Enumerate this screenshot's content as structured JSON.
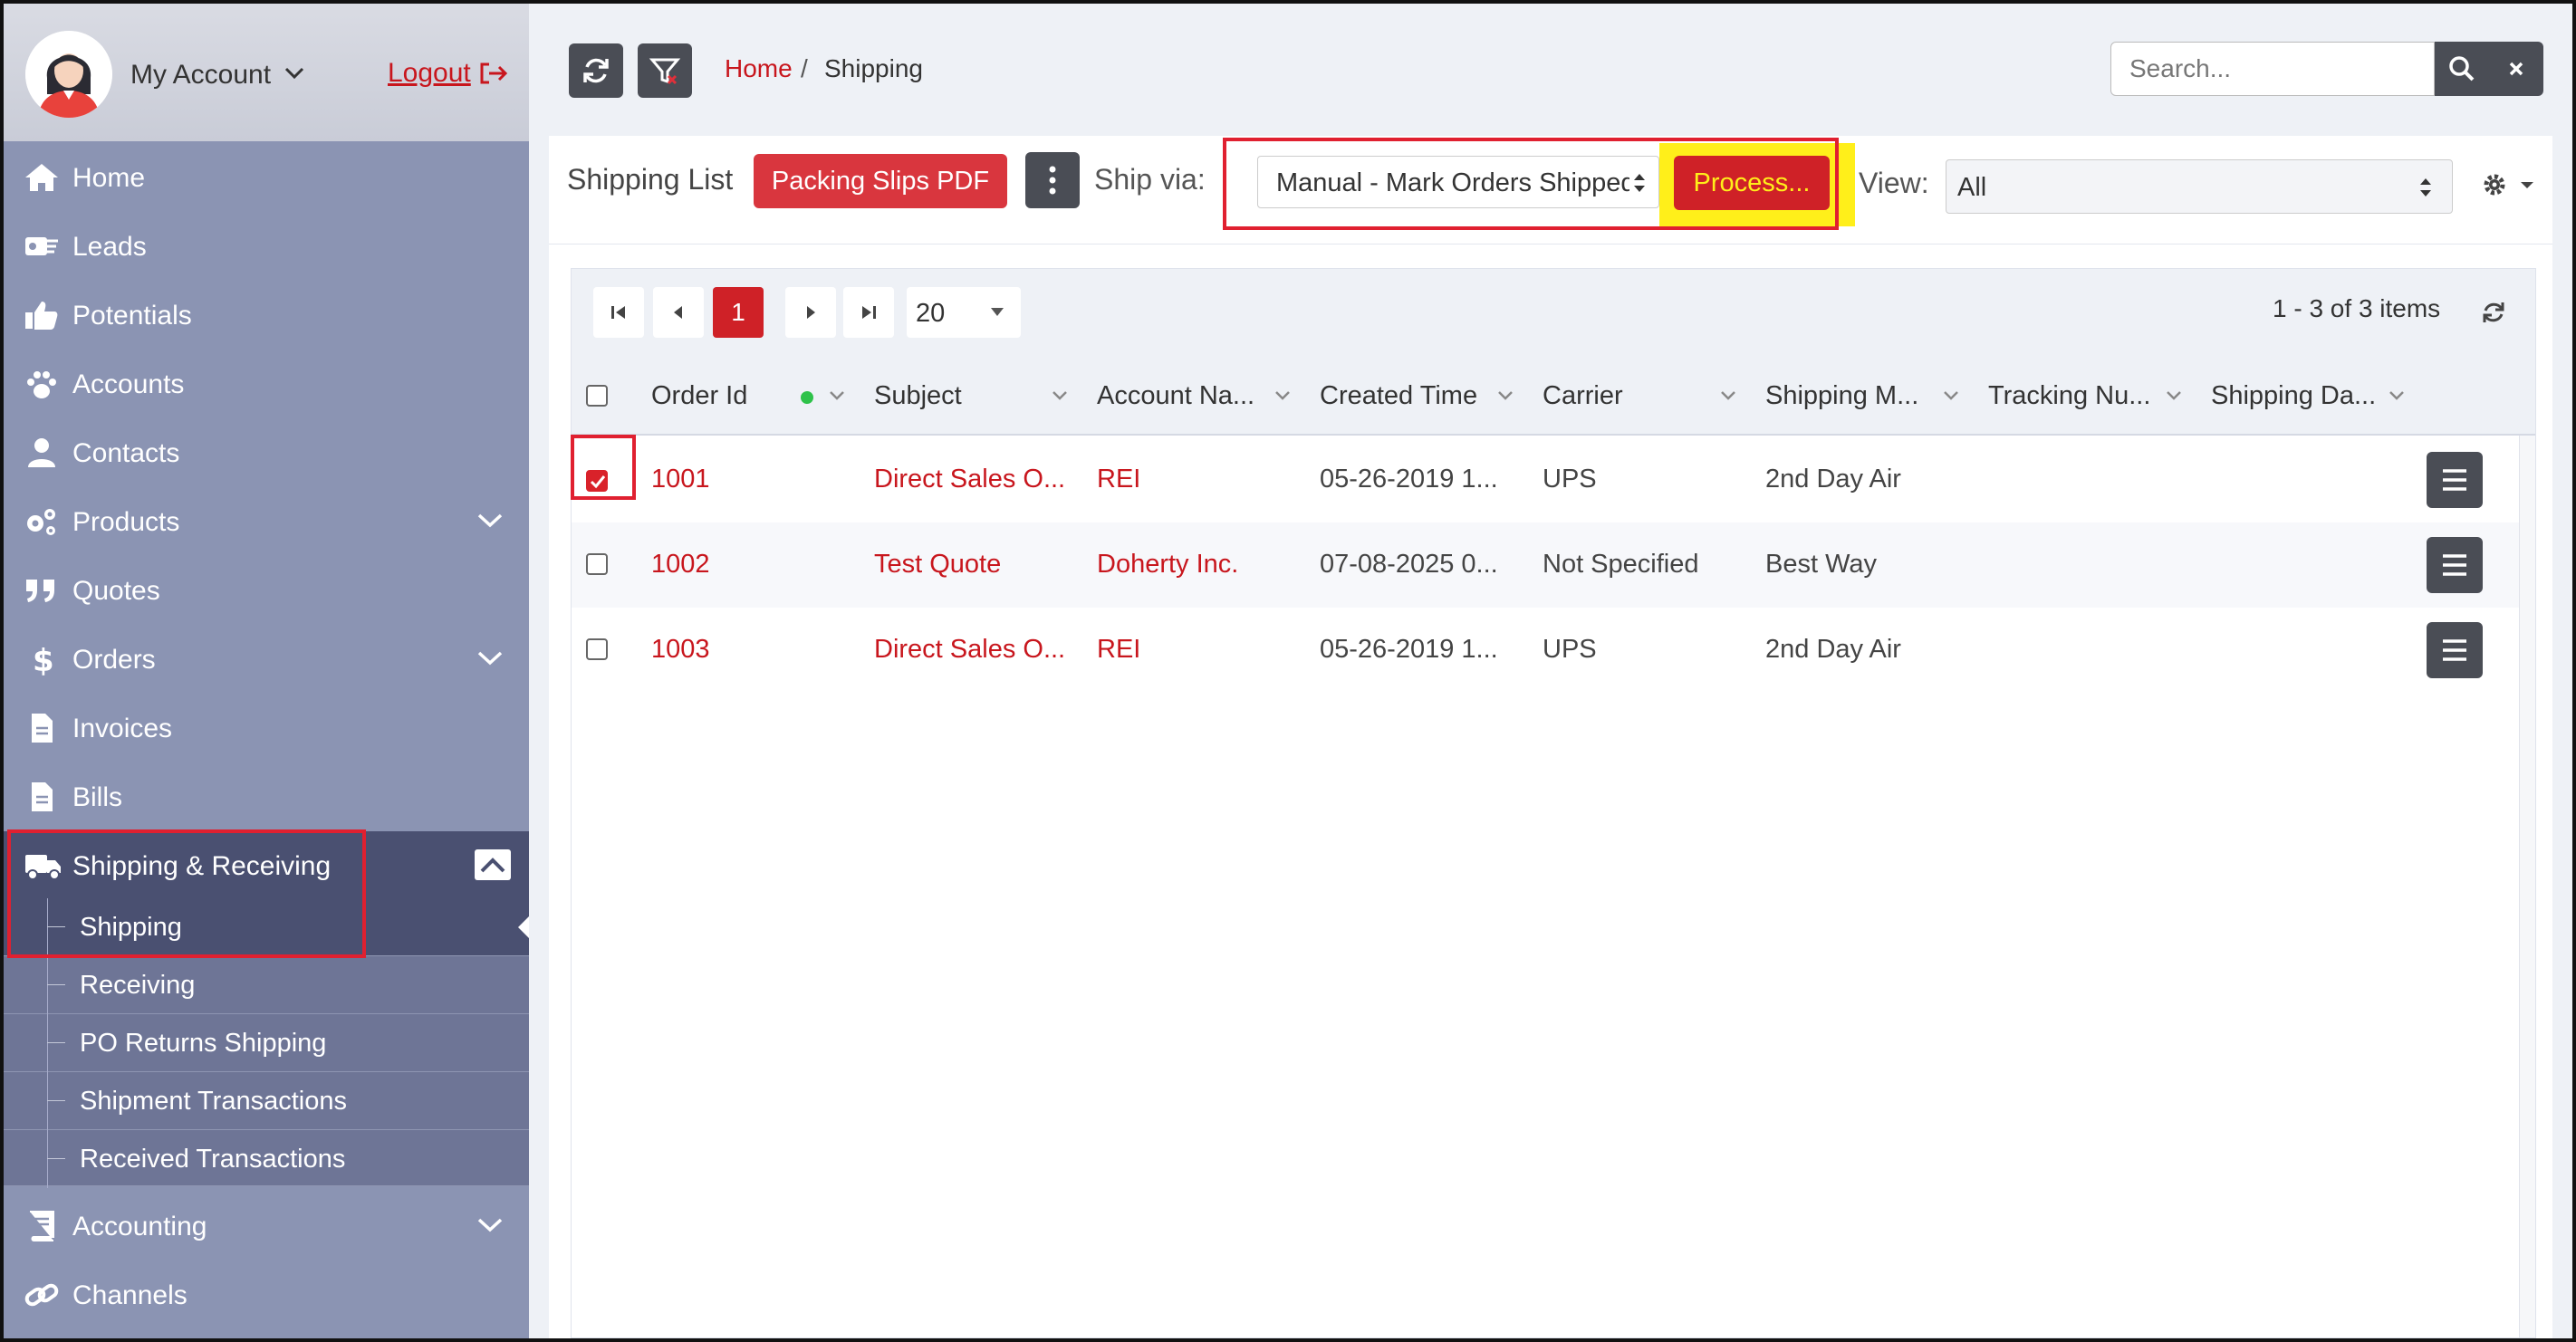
{
  "account": {
    "label": "My Account",
    "logout": "Logout"
  },
  "sidebar": {
    "items": [
      {
        "label": "Home",
        "icon": "home-icon"
      },
      {
        "label": "Leads",
        "icon": "leads-icon"
      },
      {
        "label": "Potentials",
        "icon": "thumbs-up-icon"
      },
      {
        "label": "Accounts",
        "icon": "paw-icon"
      },
      {
        "label": "Contacts",
        "icon": "user-icon"
      },
      {
        "label": "Products",
        "icon": "gears-icon"
      },
      {
        "label": "Quotes",
        "icon": "quote-icon"
      },
      {
        "label": "Orders",
        "icon": "dollar-icon"
      },
      {
        "label": "Invoices",
        "icon": "document-icon"
      },
      {
        "label": "Bills",
        "icon": "document-icon"
      },
      {
        "label": "Shipping & Receiving",
        "icon": "truck-icon"
      },
      {
        "label": "Accounting",
        "icon": "book-icon"
      },
      {
        "label": "Channels",
        "icon": "link-icon"
      }
    ],
    "sub_items": [
      {
        "label": "Shipping"
      },
      {
        "label": "Receiving"
      },
      {
        "label": "PO Returns Shipping"
      },
      {
        "label": "Shipment Transactions"
      },
      {
        "label": "Received Transactions"
      }
    ]
  },
  "breadcrumb": {
    "home": "Home",
    "separator": "/",
    "current": "Shipping"
  },
  "search": {
    "placeholder": "Search..."
  },
  "toolbar": {
    "title": "Shipping List",
    "packing_slips": "Packing Slips PDF",
    "ship_via_label": "Ship via:",
    "ship_via_value": "Manual - Mark Orders Shipped",
    "process": "Process...",
    "view_label": "View:",
    "view_value": "All"
  },
  "pager": {
    "current_page": "1",
    "page_size": "20",
    "info": "1 - 3 of 3 items"
  },
  "columns": [
    "Order Id",
    "Subject",
    "Account Na...",
    "Created Time",
    "Carrier",
    "Shipping M...",
    "Tracking Nu...",
    "Shipping Da..."
  ],
  "rows": [
    {
      "checked": true,
      "order_id": "1001",
      "subject": "Direct Sales O...",
      "account": "REI",
      "created": "05-26-2019 1...",
      "carrier": "UPS",
      "method": "2nd Day Air",
      "tracking": "",
      "ship_date": ""
    },
    {
      "checked": false,
      "order_id": "1002",
      "subject": "Test Quote",
      "account": "Doherty Inc.",
      "created": "07-08-2025 0...",
      "carrier": "Not Specified",
      "method": "Best Way",
      "tracking": "",
      "ship_date": ""
    },
    {
      "checked": false,
      "order_id": "1003",
      "subject": "Direct Sales O...",
      "account": "REI",
      "created": "05-26-2019 1...",
      "carrier": "UPS",
      "method": "2nd Day Air",
      "tracking": "",
      "ship_date": ""
    }
  ],
  "colors": {
    "accent": "#c8161d",
    "sidebar": "#8b94b3",
    "sidebar_active": "#4a5071",
    "highlight": "#ffef1a",
    "annotation": "#e02030"
  }
}
